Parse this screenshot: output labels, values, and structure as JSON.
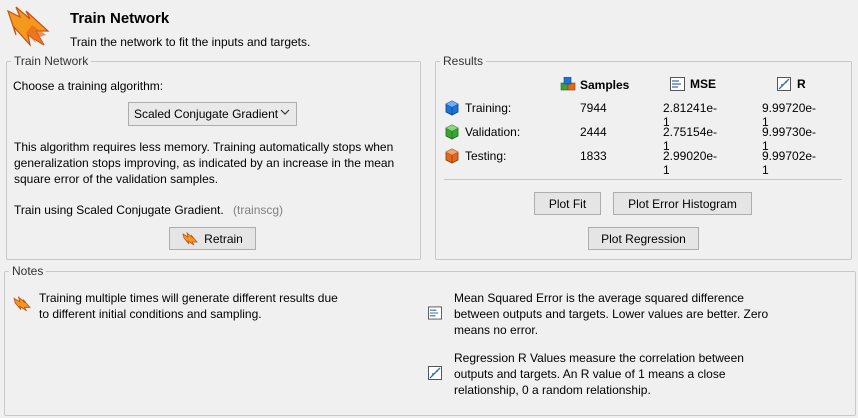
{
  "header": {
    "title": "Train Network",
    "subtitle": "Train the network to fit the inputs and targets."
  },
  "train_panel": {
    "legend": "Train Network",
    "choose_label": "Choose a training algorithm:",
    "algorithm_selected": "Scaled Conjugate Gradient",
    "description_lines": [
      "This algorithm requires less memory. Training automatically stops when",
      "generalization stops improving, as indicated by an increase in the mean",
      "square error of the validation samples."
    ],
    "train_using_label": "Train using Scaled Conjugate Gradient.",
    "train_fn": "(trainscg)",
    "retrain_label": "Retrain"
  },
  "results_panel": {
    "legend": "Results",
    "columns": {
      "samples": "Samples",
      "mse": "MSE",
      "r": "R"
    },
    "rows": [
      {
        "label": "Training:",
        "samples": "7944",
        "mse": "2.81241e-1",
        "r": "9.99720e-1",
        "color": "#1e73d8"
      },
      {
        "label": "Validation:",
        "samples": "2444",
        "mse": "2.75154e-1",
        "r": "9.99730e-1",
        "color": "#3aa335"
      },
      {
        "label": "Testing:",
        "samples": "1833",
        "mse": "2.99020e-1",
        "r": "9.99702e-1",
        "color": "#e2681c"
      }
    ],
    "buttons": {
      "plot_fit": "Plot Fit",
      "plot_error_histogram": "Plot Error Histogram",
      "plot_regression": "Plot Regression"
    }
  },
  "notes_panel": {
    "legend": "Notes",
    "note_train": [
      "Training multiple times will generate different results due",
      "to different initial conditions and sampling."
    ],
    "note_mse": [
      "Mean Squared Error is the average squared difference",
      "between outputs and targets. Lower values are better. Zero",
      "means no error."
    ],
    "note_r": [
      "Regression R Values measure the correlation between",
      "outputs and targets. An R value of 1 means a close",
      "relationship, 0 a random relationship."
    ]
  }
}
